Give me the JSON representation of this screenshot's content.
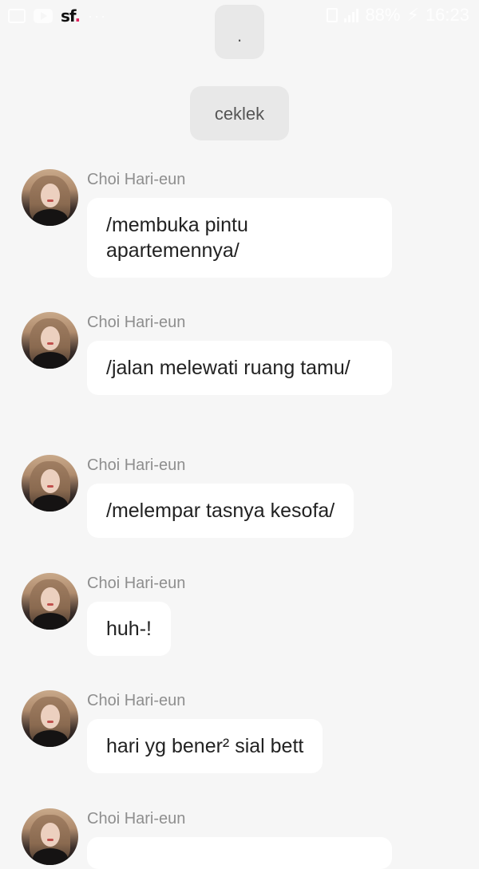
{
  "status_bar": {
    "logo_text": "sf",
    "logo_dot": ".",
    "overflow_dots": "···",
    "battery_text": "88%",
    "time": "16:23"
  },
  "system_messages": [
    {
      "text": "."
    },
    {
      "text": "ceklek"
    }
  ],
  "messages": [
    {
      "sender": "Choi Hari-eun",
      "text": "/membuka pintu apartemennya/"
    },
    {
      "sender": "Choi Hari-eun",
      "text": "/jalan melewati ruang tamu/"
    },
    {
      "sender": "Choi Hari-eun",
      "text": "/melempar tasnya kesofa/"
    },
    {
      "sender": "Choi Hari-eun",
      "text": "huh-!"
    },
    {
      "sender": "Choi Hari-eun",
      "text": "hari yg bener² sial bett"
    },
    {
      "sender": "Choi Hari-eun",
      "text": ""
    }
  ]
}
